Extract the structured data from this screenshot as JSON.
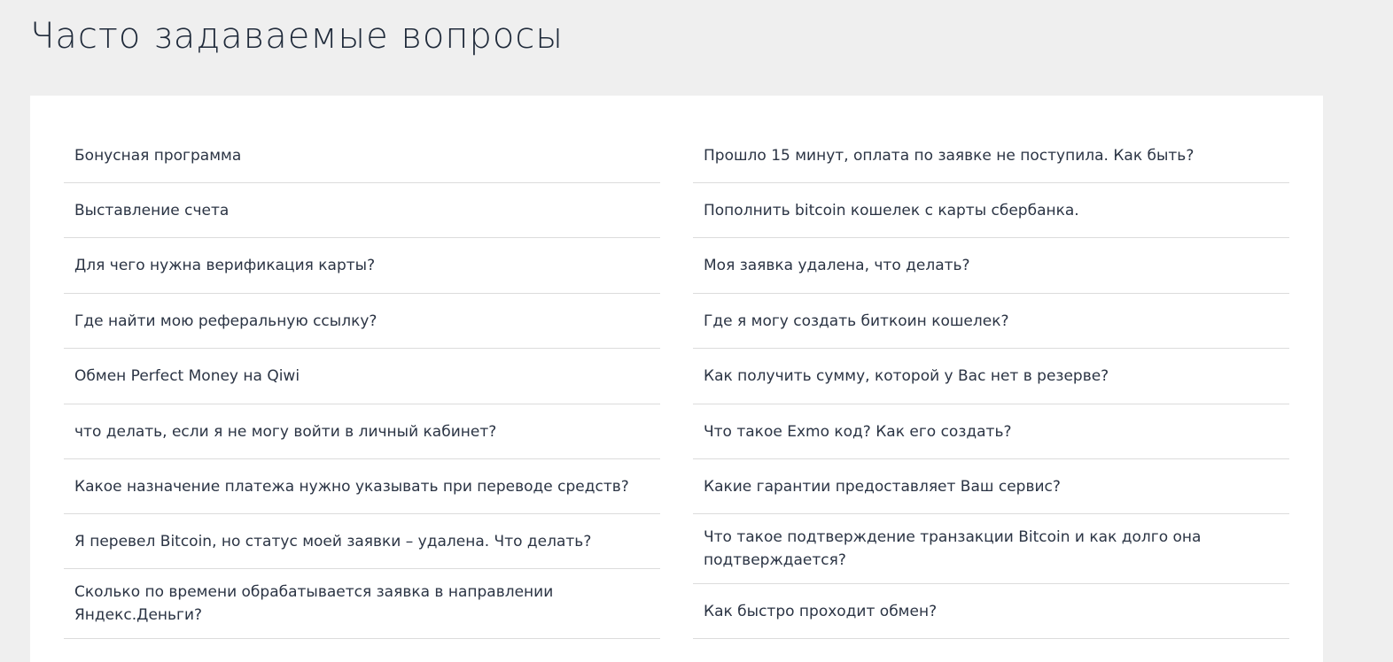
{
  "page": {
    "title": "Часто задаваемые вопросы"
  },
  "faq": {
    "left": [
      "Бонусная программа",
      "Выставление счета",
      "Для чего нужна верификация карты?",
      "Где найти мою реферальную ссылку?",
      "Обмен Perfect Money на Qiwi",
      "что делать, если я не могу войти в личный кабинет?",
      "Какое назначение платежа нужно указывать при переводе средств?",
      "Я перевел Bitcoin, но статус моей заявки – удалена. Что делать?",
      "Сколько по времени обрабатывается заявка в направлении Яндекс.Деньги?"
    ],
    "right": [
      "Прошло 15 минут, оплата по заявке не поступила. Как быть?",
      "Пополнить bitcoin кошелек с карты сбербанка.",
      "Моя заявка удалена, что делать?",
      "Где я могу создать биткоин кошелек?",
      "Как получить сумму, которой у Вас нет в резерве?",
      "Что такое Exmo код? Как его создать?",
      "Какие гарантии предоставляет Ваш сервис?",
      "Что такое подтверждение транзакции Bitcoin и как долго она подтверждается?",
      "Как быстро проходит обмен?"
    ]
  }
}
